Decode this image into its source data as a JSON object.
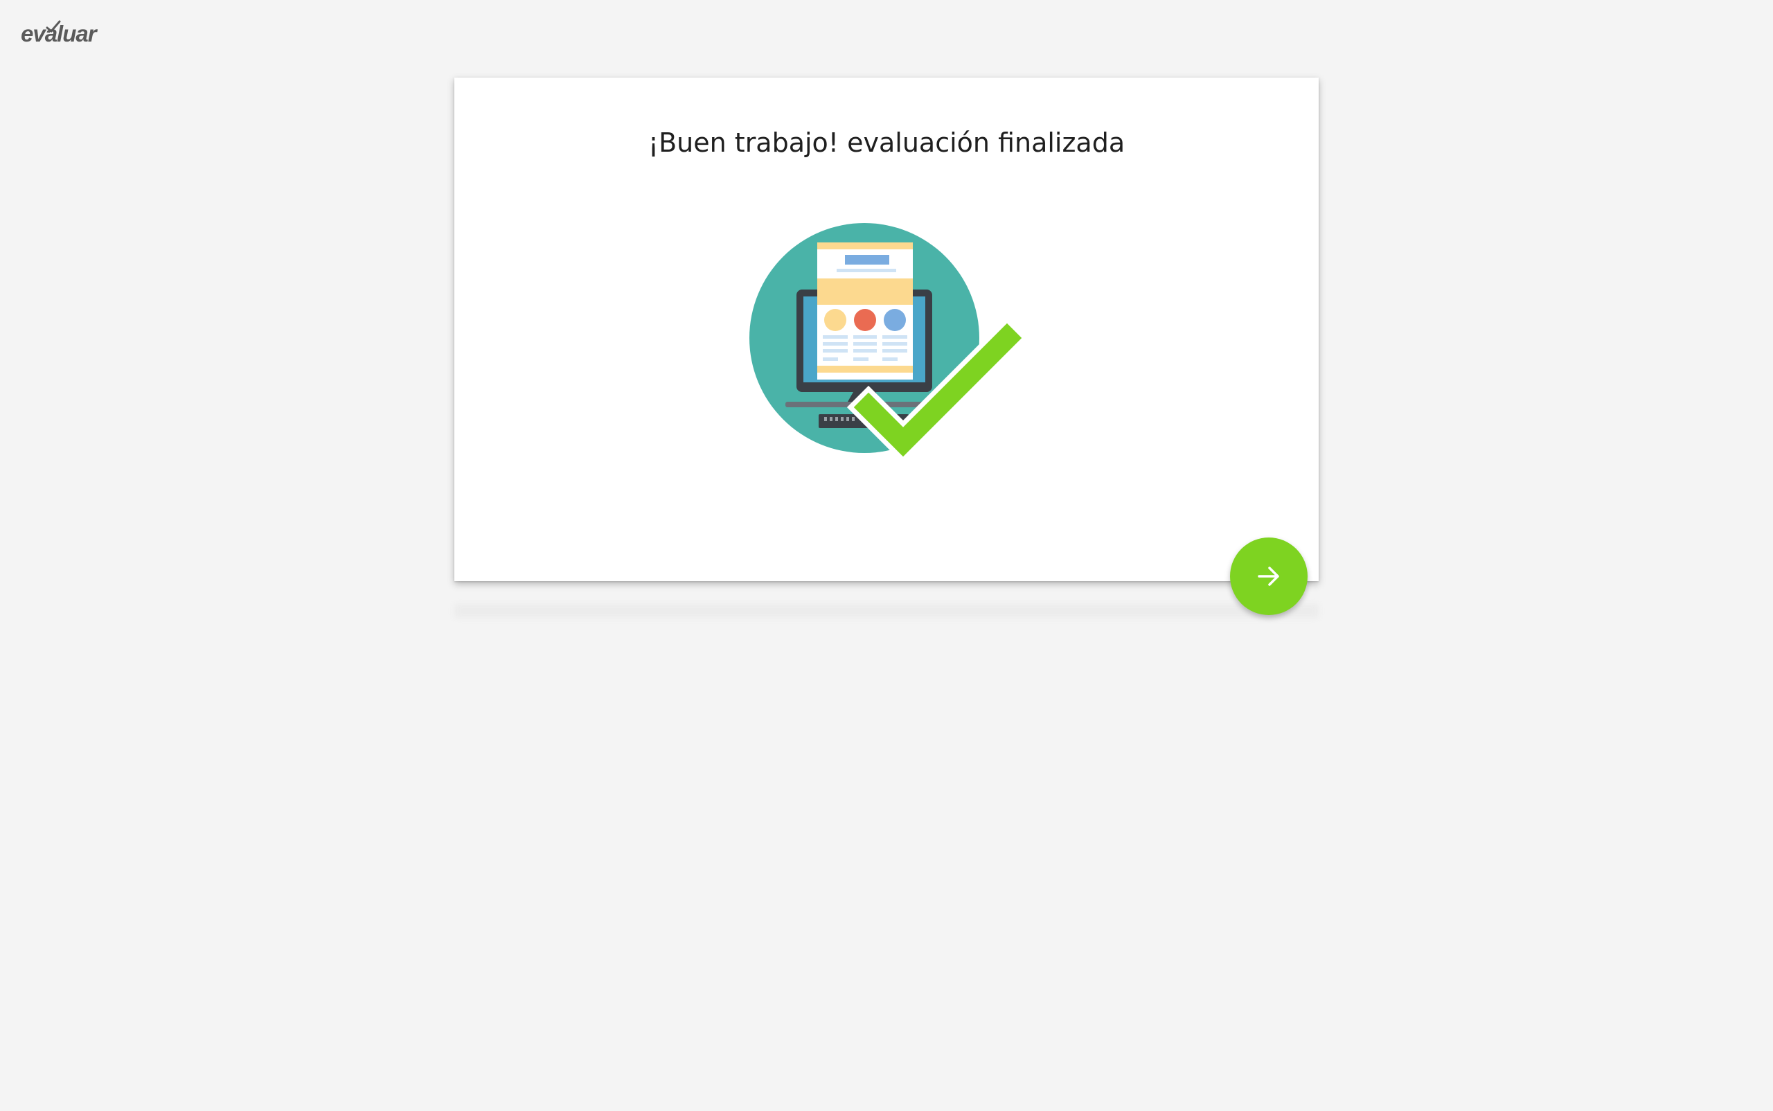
{
  "header": {
    "logo_text": "evaluar"
  },
  "card": {
    "title": "¡Buen trabajo! evaluación finalizada",
    "illustration": "computer-checkmark-illustration"
  },
  "actions": {
    "next_icon": "arrow-right-icon"
  },
  "colors": {
    "background": "#f4f4f4",
    "card": "#ffffff",
    "accent_green": "#7ed321",
    "teal_circle": "#4ab3a8"
  }
}
